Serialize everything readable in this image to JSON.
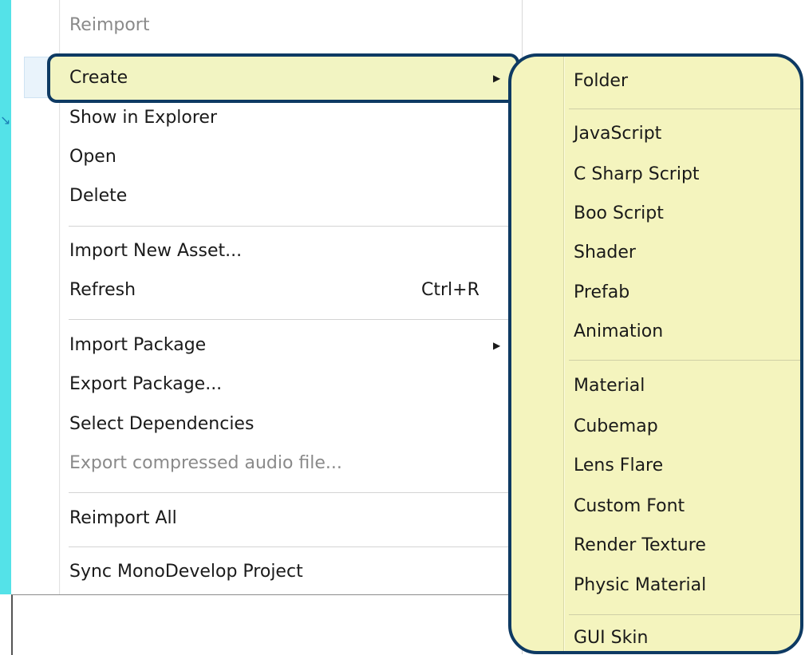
{
  "menu": {
    "items": [
      {
        "label": "Reimport",
        "disabled": true
      },
      {
        "label": "Create",
        "submenu": true
      },
      {
        "label": "Show in Explorer"
      },
      {
        "label": "Open"
      },
      {
        "label": "Delete"
      },
      {
        "label": "Import New Asset..."
      },
      {
        "label": "Refresh",
        "shortcut": "Ctrl+R"
      },
      {
        "label": "Import Package",
        "submenu": true
      },
      {
        "label": "Export Package..."
      },
      {
        "label": "Select Dependencies"
      },
      {
        "label": "Export compressed audio file...",
        "disabled": true
      },
      {
        "label": "Reimport All"
      },
      {
        "label": "Sync MonoDevelop Project"
      }
    ]
  },
  "submenu": {
    "items": [
      {
        "label": "Folder"
      },
      {
        "label": "JavaScript"
      },
      {
        "label": "C Sharp Script"
      },
      {
        "label": "Boo Script"
      },
      {
        "label": "Shader"
      },
      {
        "label": "Prefab"
      },
      {
        "label": "Animation"
      },
      {
        "label": "Material"
      },
      {
        "label": "Cubemap"
      },
      {
        "label": "Lens Flare"
      },
      {
        "label": "Custom Font"
      },
      {
        "label": "Render Texture"
      },
      {
        "label": "Physic Material"
      },
      {
        "label": "GUI Skin"
      }
    ]
  },
  "icons": {
    "submenu_arrow": "▶",
    "pointer_arrow": "↘"
  },
  "colors": {
    "accent_border": "#0e3a63",
    "highlight_fill": "#f4f4be",
    "side_strip": "#54e2e8"
  }
}
